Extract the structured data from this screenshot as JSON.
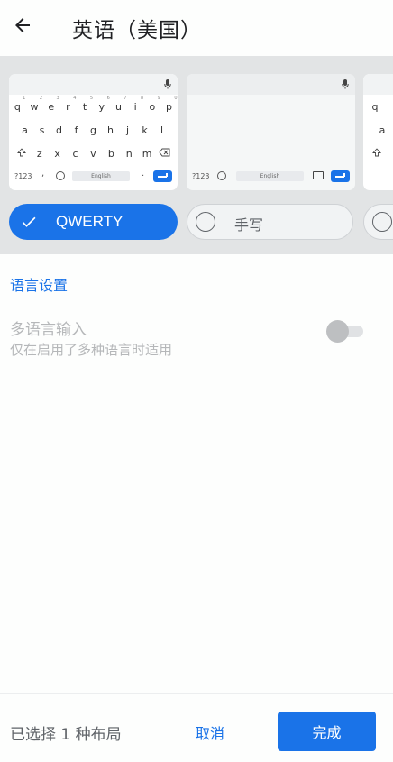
{
  "header": {
    "title": "英语（美国）",
    "back_icon": "arrow-left-icon"
  },
  "layouts": [
    {
      "name": "QWERTY",
      "selected": true,
      "preview": {
        "row1": [
          "q",
          "w",
          "e",
          "r",
          "t",
          "y",
          "u",
          "i",
          "o",
          "p"
        ],
        "row1_hints": [
          "1",
          "2",
          "3",
          "4",
          "5",
          "6",
          "7",
          "8",
          "9",
          "0"
        ],
        "row2": [
          "a",
          "s",
          "d",
          "f",
          "g",
          "h",
          "j",
          "k",
          "l"
        ],
        "row3": [
          "z",
          "x",
          "c",
          "v",
          "b",
          "n",
          "m"
        ],
        "symbols_key": "?123",
        "comma_key": ",",
        "space_label": "English",
        "period_key": "."
      }
    },
    {
      "name": "手写",
      "selected": false,
      "preview": {
        "symbols_key": "?123",
        "space_label": "English"
      }
    },
    {
      "name": "",
      "selected": false,
      "preview": {
        "row1": [
          "q"
        ],
        "row2": [
          "a"
        ]
      }
    }
  ],
  "language_settings": {
    "section_title": "语言设置",
    "multilingual": {
      "title": "多语言输入",
      "subtitle": "仅在启用了多种语言时适用",
      "enabled": false
    }
  },
  "footer": {
    "status": "已选择 1 种布局",
    "cancel_label": "取消",
    "done_label": "完成"
  },
  "colors": {
    "accent": "#1a73e8",
    "strip_bg": "#e2e4e5",
    "disabled_text": "#b5b7b9"
  }
}
